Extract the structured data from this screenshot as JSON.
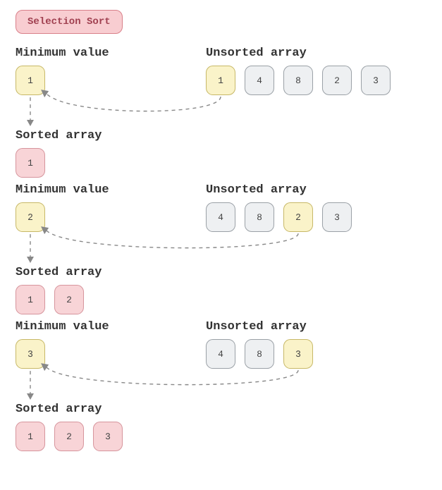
{
  "title": "Selection Sort",
  "labels": {
    "min": "Minimum value",
    "unsorted": "Unsorted array",
    "sorted": "Sorted array"
  },
  "steps": [
    {
      "min": 1,
      "unsorted": [
        {
          "v": 1,
          "hl": true
        },
        {
          "v": 4,
          "hl": false
        },
        {
          "v": 8,
          "hl": false
        },
        {
          "v": 2,
          "hl": false
        },
        {
          "v": 3,
          "hl": false
        }
      ],
      "sorted": [
        1
      ]
    },
    {
      "min": 2,
      "unsorted": [
        {
          "v": 4,
          "hl": false
        },
        {
          "v": 8,
          "hl": false
        },
        {
          "v": 2,
          "hl": true
        },
        {
          "v": 3,
          "hl": false
        }
      ],
      "sorted": [
        1,
        2
      ]
    },
    {
      "min": 3,
      "unsorted": [
        {
          "v": 4,
          "hl": false
        },
        {
          "v": 8,
          "hl": false
        },
        {
          "v": 3,
          "hl": true
        }
      ],
      "sorted": [
        1,
        2,
        3
      ]
    }
  ]
}
